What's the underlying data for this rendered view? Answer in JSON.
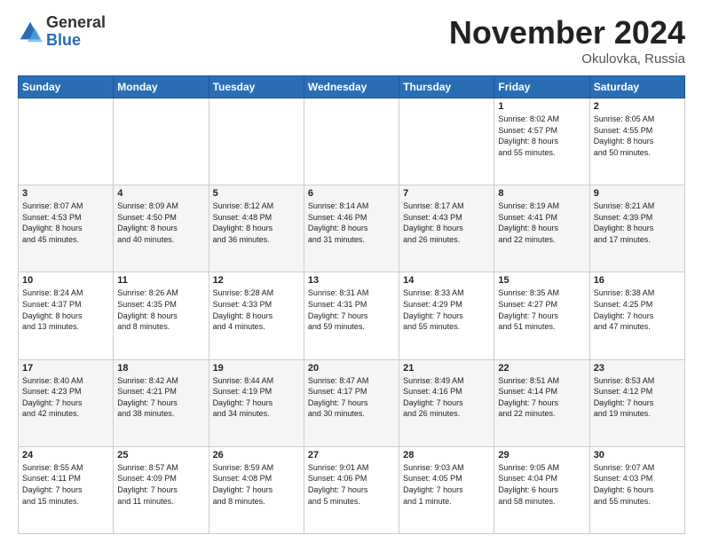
{
  "header": {
    "logo_general": "General",
    "logo_blue": "Blue",
    "month_title": "November 2024",
    "location": "Okulovka, Russia"
  },
  "weekdays": [
    "Sunday",
    "Monday",
    "Tuesday",
    "Wednesday",
    "Thursday",
    "Friday",
    "Saturday"
  ],
  "rows": [
    [
      {
        "day": "",
        "info": ""
      },
      {
        "day": "",
        "info": ""
      },
      {
        "day": "",
        "info": ""
      },
      {
        "day": "",
        "info": ""
      },
      {
        "day": "",
        "info": ""
      },
      {
        "day": "1",
        "info": "Sunrise: 8:02 AM\nSunset: 4:57 PM\nDaylight: 8 hours\nand 55 minutes."
      },
      {
        "day": "2",
        "info": "Sunrise: 8:05 AM\nSunset: 4:55 PM\nDaylight: 8 hours\nand 50 minutes."
      }
    ],
    [
      {
        "day": "3",
        "info": "Sunrise: 8:07 AM\nSunset: 4:53 PM\nDaylight: 8 hours\nand 45 minutes."
      },
      {
        "day": "4",
        "info": "Sunrise: 8:09 AM\nSunset: 4:50 PM\nDaylight: 8 hours\nand 40 minutes."
      },
      {
        "day": "5",
        "info": "Sunrise: 8:12 AM\nSunset: 4:48 PM\nDaylight: 8 hours\nand 36 minutes."
      },
      {
        "day": "6",
        "info": "Sunrise: 8:14 AM\nSunset: 4:46 PM\nDaylight: 8 hours\nand 31 minutes."
      },
      {
        "day": "7",
        "info": "Sunrise: 8:17 AM\nSunset: 4:43 PM\nDaylight: 8 hours\nand 26 minutes."
      },
      {
        "day": "8",
        "info": "Sunrise: 8:19 AM\nSunset: 4:41 PM\nDaylight: 8 hours\nand 22 minutes."
      },
      {
        "day": "9",
        "info": "Sunrise: 8:21 AM\nSunset: 4:39 PM\nDaylight: 8 hours\nand 17 minutes."
      }
    ],
    [
      {
        "day": "10",
        "info": "Sunrise: 8:24 AM\nSunset: 4:37 PM\nDaylight: 8 hours\nand 13 minutes."
      },
      {
        "day": "11",
        "info": "Sunrise: 8:26 AM\nSunset: 4:35 PM\nDaylight: 8 hours\nand 8 minutes."
      },
      {
        "day": "12",
        "info": "Sunrise: 8:28 AM\nSunset: 4:33 PM\nDaylight: 8 hours\nand 4 minutes."
      },
      {
        "day": "13",
        "info": "Sunrise: 8:31 AM\nSunset: 4:31 PM\nDaylight: 7 hours\nand 59 minutes."
      },
      {
        "day": "14",
        "info": "Sunrise: 8:33 AM\nSunset: 4:29 PM\nDaylight: 7 hours\nand 55 minutes."
      },
      {
        "day": "15",
        "info": "Sunrise: 8:35 AM\nSunset: 4:27 PM\nDaylight: 7 hours\nand 51 minutes."
      },
      {
        "day": "16",
        "info": "Sunrise: 8:38 AM\nSunset: 4:25 PM\nDaylight: 7 hours\nand 47 minutes."
      }
    ],
    [
      {
        "day": "17",
        "info": "Sunrise: 8:40 AM\nSunset: 4:23 PM\nDaylight: 7 hours\nand 42 minutes."
      },
      {
        "day": "18",
        "info": "Sunrise: 8:42 AM\nSunset: 4:21 PM\nDaylight: 7 hours\nand 38 minutes."
      },
      {
        "day": "19",
        "info": "Sunrise: 8:44 AM\nSunset: 4:19 PM\nDaylight: 7 hours\nand 34 minutes."
      },
      {
        "day": "20",
        "info": "Sunrise: 8:47 AM\nSunset: 4:17 PM\nDaylight: 7 hours\nand 30 minutes."
      },
      {
        "day": "21",
        "info": "Sunrise: 8:49 AM\nSunset: 4:16 PM\nDaylight: 7 hours\nand 26 minutes."
      },
      {
        "day": "22",
        "info": "Sunrise: 8:51 AM\nSunset: 4:14 PM\nDaylight: 7 hours\nand 22 minutes."
      },
      {
        "day": "23",
        "info": "Sunrise: 8:53 AM\nSunset: 4:12 PM\nDaylight: 7 hours\nand 19 minutes."
      }
    ],
    [
      {
        "day": "24",
        "info": "Sunrise: 8:55 AM\nSunset: 4:11 PM\nDaylight: 7 hours\nand 15 minutes."
      },
      {
        "day": "25",
        "info": "Sunrise: 8:57 AM\nSunset: 4:09 PM\nDaylight: 7 hours\nand 11 minutes."
      },
      {
        "day": "26",
        "info": "Sunrise: 8:59 AM\nSunset: 4:08 PM\nDaylight: 7 hours\nand 8 minutes."
      },
      {
        "day": "27",
        "info": "Sunrise: 9:01 AM\nSunset: 4:06 PM\nDaylight: 7 hours\nand 5 minutes."
      },
      {
        "day": "28",
        "info": "Sunrise: 9:03 AM\nSunset: 4:05 PM\nDaylight: 7 hours\nand 1 minute."
      },
      {
        "day": "29",
        "info": "Sunrise: 9:05 AM\nSunset: 4:04 PM\nDaylight: 6 hours\nand 58 minutes."
      },
      {
        "day": "30",
        "info": "Sunrise: 9:07 AM\nSunset: 4:03 PM\nDaylight: 6 hours\nand 55 minutes."
      }
    ]
  ]
}
